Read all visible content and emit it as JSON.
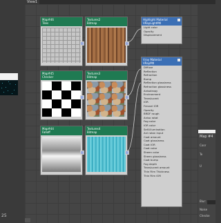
{
  "window": {
    "view_tab": "View1"
  },
  "left": {
    "bottom_label": "25"
  },
  "nodes": [
    {
      "id": "n1",
      "name": "Map#46",
      "type": "Tiles",
      "texture": "grid"
    },
    {
      "id": "n2",
      "name": "Textures2",
      "type": "Bitmap",
      "texture": "wood"
    },
    {
      "id": "n3",
      "name": "Map#45",
      "type": "Checker",
      "texture": "checker"
    },
    {
      "id": "n4",
      "name": "Textures3",
      "type": "Bitmap",
      "texture": "pebble"
    },
    {
      "id": "n5",
      "name": "Map#44",
      "type": "Falloff",
      "texture": "metal"
    },
    {
      "id": "n6",
      "name": "Textures4",
      "type": "Bitmap",
      "texture": "water"
    }
  ],
  "mat_small": {
    "title": "Highlight Material",
    "subtitle": "VRayLightMtl",
    "slots": [
      "Light color",
      "Opacity",
      "Displacement"
    ]
  },
  "mat_large": {
    "title": "Vray Material",
    "subtitle": "VRayMtl",
    "slots": [
      "Diffuse",
      "Reflection",
      "Refraction",
      "Bump",
      "Reflection glossiness",
      "Refraction glossiness",
      "Anisotropy",
      "Environment",
      "Translucent",
      "IOR",
      "Fresnel IOR",
      "Opacity",
      "BRDF rough",
      "Aniso rotat",
      "Fog color",
      "IOR color",
      "Self-illumination",
      "Anl rotan input",
      "Coat amount",
      "Coat glossiness",
      "Coat IOR",
      "Coat color",
      "Sheen color",
      "Sheen glossiness",
      "Coat bump",
      "Fog depth",
      "Translucent amount",
      "Thin Film Thickness",
      "Thin Film IOR"
    ]
  },
  "right_panel": {
    "map_label": "Map #4",
    "rows": [
      "Coor",
      "Te",
      "U",
      "Blur:",
      "Noise",
      "Checke"
    ]
  },
  "colors": {
    "node_header": "#1f7a52",
    "material_header": "#3b6fb5",
    "canvas": "#454545"
  }
}
